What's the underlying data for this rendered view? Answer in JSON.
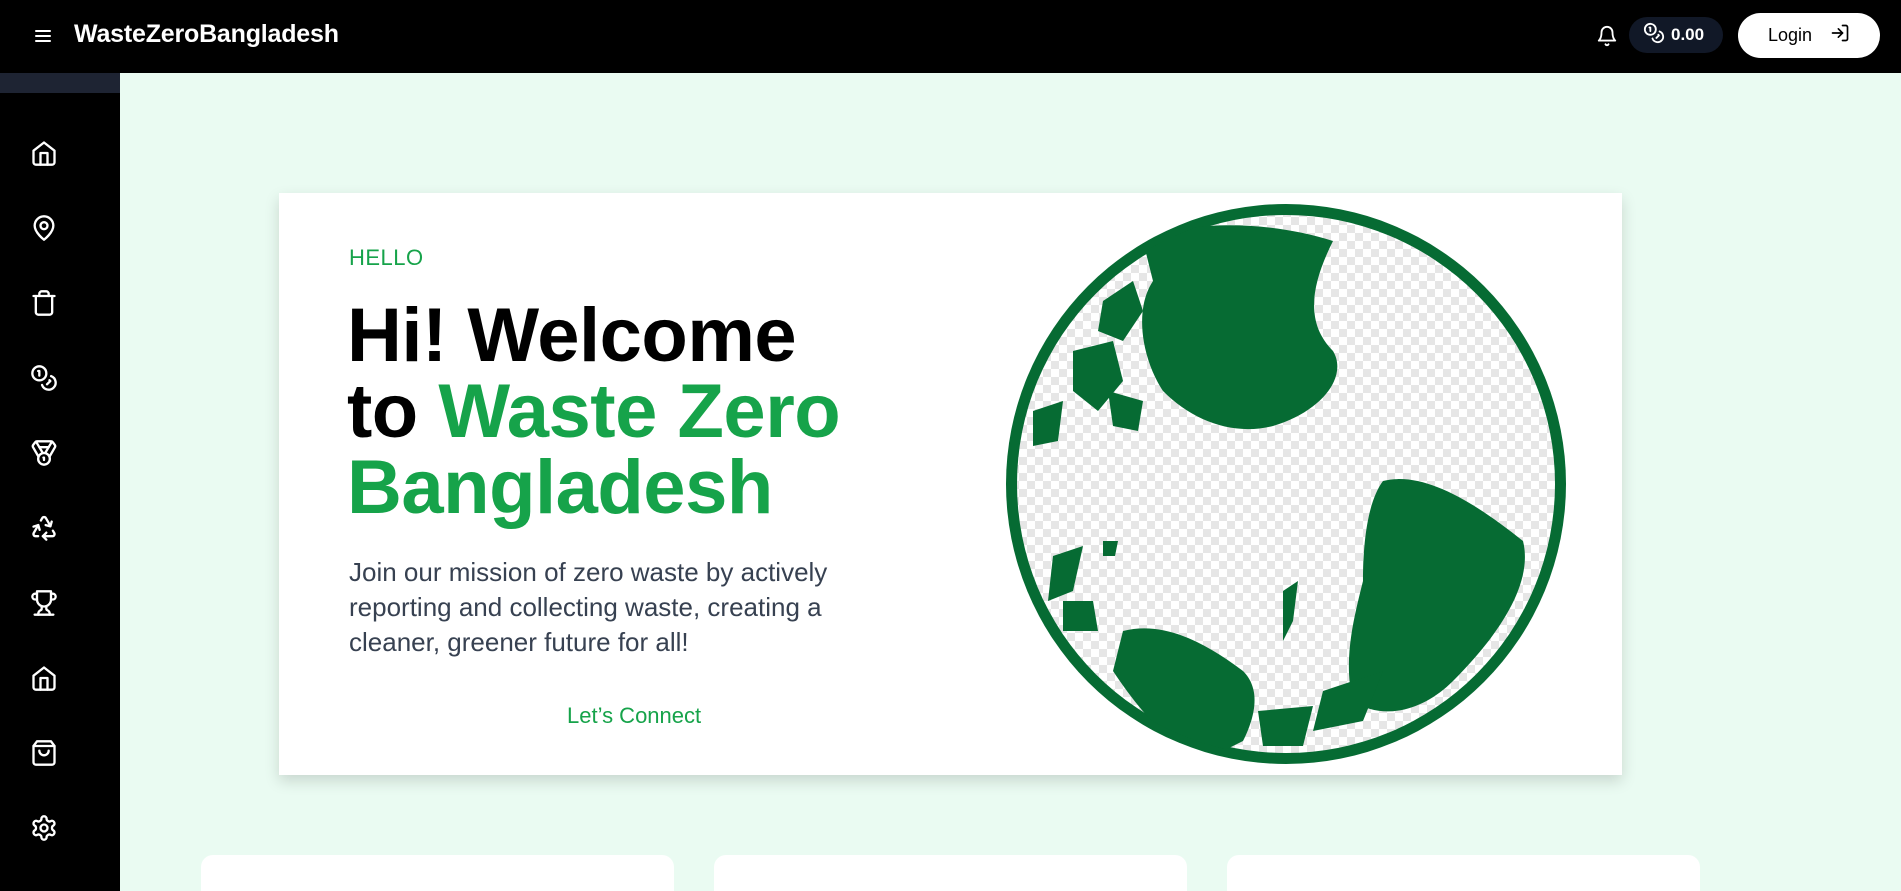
{
  "header": {
    "brand": "WasteZeroBangladesh",
    "balance": "0.00",
    "login_label": "Login"
  },
  "sidebar": {
    "items": [
      {
        "name": "home-icon"
      },
      {
        "name": "map-pin-icon"
      },
      {
        "name": "trash-icon"
      },
      {
        "name": "coins-icon"
      },
      {
        "name": "medal-icon"
      },
      {
        "name": "recycle-icon"
      },
      {
        "name": "trophy-icon"
      },
      {
        "name": "home-icon"
      },
      {
        "name": "shopping-bag-icon"
      },
      {
        "name": "gear-icon"
      }
    ]
  },
  "hero": {
    "hello": "HELLO",
    "title_line1": "Hi! Welcome",
    "title_to": "to ",
    "title_green": "Waste Zero Bangladesh",
    "description": "Join our mission of zero waste by actively reporting and collecting waste, creating a cleaner, greener future for all!",
    "cta": "Let’s Connect"
  },
  "colors": {
    "accent": "#16a34a",
    "globe": "#066b33",
    "page_bg": "#eafbf2",
    "topbar": "#000000"
  }
}
